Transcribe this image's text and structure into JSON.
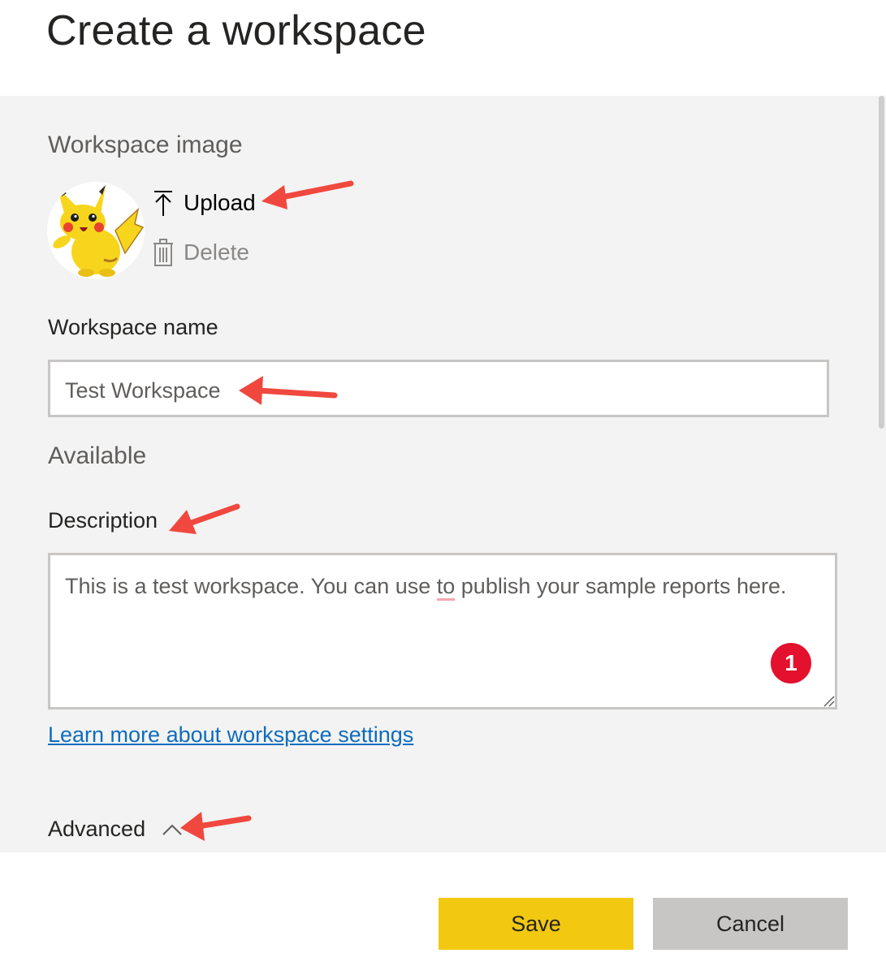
{
  "dialog": {
    "title": "Create a workspace"
  },
  "image_section": {
    "label": "Workspace image",
    "upload_label": "Upload",
    "delete_label": "Delete",
    "avatar_icon": "pikachu-avatar"
  },
  "name_section": {
    "label": "Workspace name",
    "value": "Test Workspace",
    "availability": "Available"
  },
  "description_section": {
    "label": "Description",
    "value_before": "This is a test workspace. You can use ",
    "value_misspelled": "to",
    "value_after": " publish your sample reports here.",
    "badge_count": "1"
  },
  "learn_more_link": "Learn more about workspace settings",
  "advanced": {
    "label": "Advanced",
    "icon": "chevron-up-icon"
  },
  "footer": {
    "save_label": "Save",
    "cancel_label": "Cancel"
  },
  "colors": {
    "primary_button": "#f2c811",
    "secondary_button": "#c8c6c4",
    "annotation_arrow": "#f0483e",
    "badge": "#e3102e",
    "link": "#0f6cbd"
  }
}
